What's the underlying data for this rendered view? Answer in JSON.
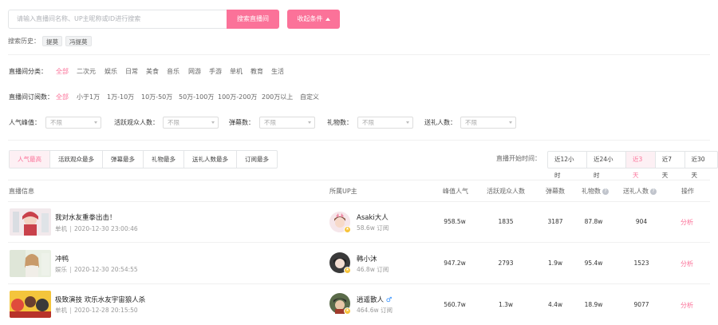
{
  "search": {
    "placeholder": "请输入直播间名称、UP主昵称或ID进行搜索",
    "button": "搜索直播间",
    "filter_button": "收起条件"
  },
  "history": {
    "label": "搜索历史：",
    "tags": [
      "提莫",
      "冯提莫"
    ]
  },
  "category": {
    "label": "直播间分类：",
    "options": [
      "全部",
      "二次元",
      "娱乐",
      "日常",
      "美食",
      "音乐",
      "网游",
      "手游",
      "单机",
      "教育",
      "生活"
    ],
    "active": "全部"
  },
  "subscribers": {
    "label": "直播间订阅数：",
    "options": [
      "全部",
      "小于1万",
      "1万-10万",
      "10万-50万",
      "50万-100万",
      "100万-200万",
      "200万以上",
      "自定义"
    ],
    "active": "全部"
  },
  "filters": [
    {
      "label": "人气峰值：",
      "value": "不限"
    },
    {
      "label": "活跃观众人数：",
      "value": "不限"
    },
    {
      "label": "弹幕数：",
      "value": "不限"
    },
    {
      "label": "礼物数：",
      "value": "不限"
    },
    {
      "label": "送礼人数：",
      "value": "不限"
    }
  ],
  "sort_tabs": [
    "人气最高",
    "活跃观众最多",
    "弹幕最多",
    "礼物最多",
    "送礼人数最多",
    "订阅最多"
  ],
  "sort_active": "人气最高",
  "time": {
    "label": "直播开始时间：",
    "options": [
      "近12小时",
      "近24小时",
      "近3天",
      "近7天",
      "近30天"
    ],
    "active": "近3天"
  },
  "table": {
    "headers": {
      "info": "直播信息",
      "up": "所属UP主",
      "peak": "峰值人气",
      "active_viewers": "活跃观众人数",
      "danmaku": "弹幕数",
      "gifts": "礼物数",
      "gifters": "送礼人数",
      "action": "操作"
    },
    "rows": [
      {
        "title": "我对水友重拳出击！",
        "category": "单机",
        "time": "2020-12-30 23:00:46",
        "up_name": "Asaki大人",
        "up_subs": "58.6w 订阅",
        "peak": "958.5w",
        "active": "1835",
        "danmaku": "3187",
        "gifts": "87.8w",
        "gifters": "904",
        "action": "分析",
        "male": false
      },
      {
        "title": "冲鸭",
        "category": "娱乐",
        "time": "2020-12-30 20:54:55",
        "up_name": "韩小沐",
        "up_subs": "46.8w 订阅",
        "peak": "947.2w",
        "active": "2793",
        "danmaku": "1.9w",
        "gifts": "95.4w",
        "gifters": "1523",
        "action": "分析",
        "male": false
      },
      {
        "title": "极致演技 欢乐水友宇宙狼人杀",
        "category": "单机",
        "time": "2020-12-28 20:15:50",
        "up_name": "逍遥散人",
        "up_subs": "464.6w 订阅",
        "peak": "560.7w",
        "active": "1.3w",
        "danmaku": "4.4w",
        "gifts": "18.9w",
        "gifters": "9077",
        "action": "分析",
        "male": true
      }
    ]
  },
  "colors": {
    "accent": "#fb7299",
    "male": "#2a8cff",
    "badge": "#f7c33a"
  }
}
